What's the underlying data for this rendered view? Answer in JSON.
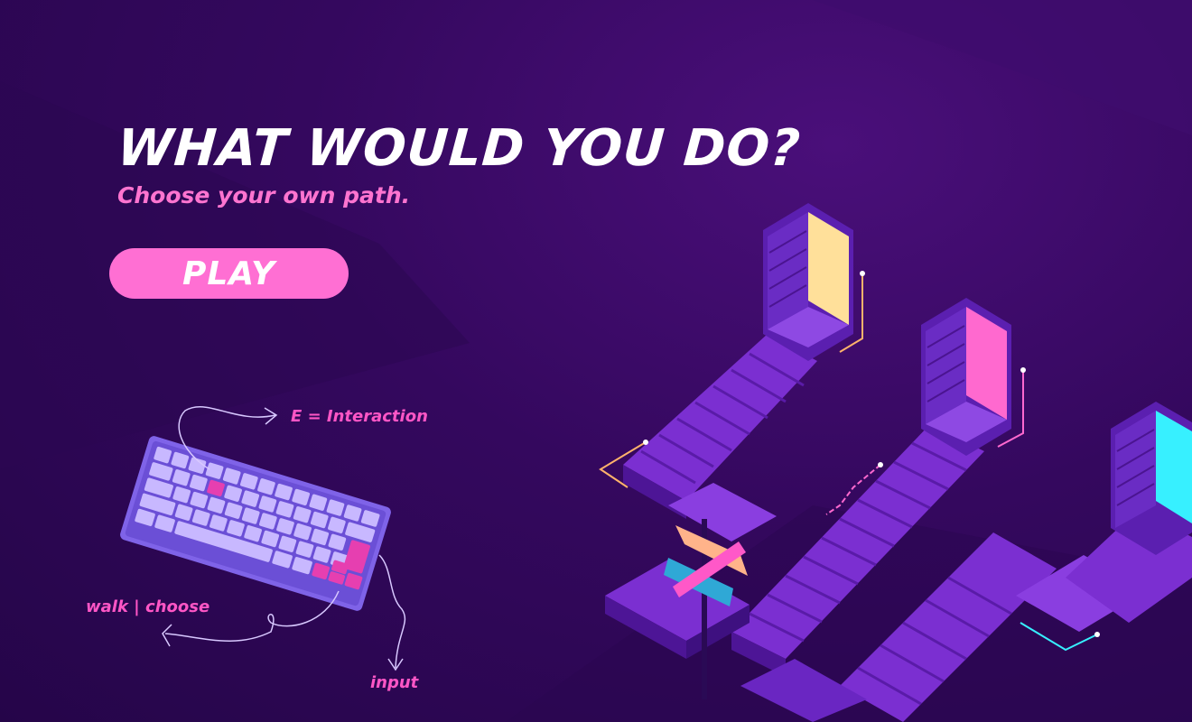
{
  "title": "WHAT WOULD YOU DO?",
  "subtitle": "Choose your own path.",
  "play_button": {
    "label": "PLAY"
  },
  "controls": {
    "interaction": "E = Interaction",
    "walk": "walk | choose",
    "input": "input"
  },
  "colors": {
    "background": "#34085e",
    "accent_pink": "#ff6fd3",
    "hint_pink": "#ff56c6",
    "door_yellow": "#ffe09a",
    "door_pink": "#ff69cf",
    "door_cyan": "#37f0ff",
    "stairs": "#7b2fd1",
    "keyboard": "#7f63e8",
    "keys": "#c8b8ff"
  },
  "icons": {
    "keyboard": "keyboard-illustration",
    "signpost": "signpost-icon"
  }
}
